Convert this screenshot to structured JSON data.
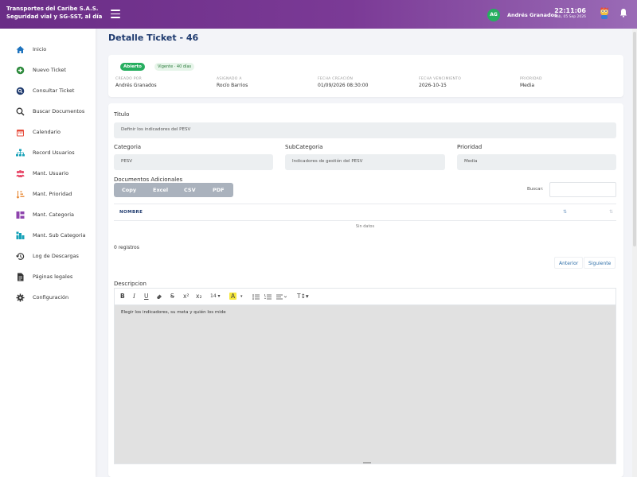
{
  "brand": {
    "line1": "Transportes del Caribe S.A.S.",
    "line2": "Seguridad vial y SG-SST, al día"
  },
  "header": {
    "user_initials": "AG",
    "user_name": "Andrés Granados",
    "time": "22:11:06",
    "date": "Sáb, 05 Sep 2026",
    "icons": [
      "menu-icon",
      "mascot-icon",
      "bell-icon"
    ]
  },
  "sidebar": {
    "items": [
      {
        "label": "Inicio",
        "icon": "home-icon",
        "color": "#1e73be"
      },
      {
        "label": "Nuevo Ticket",
        "icon": "plus-circle-icon",
        "color": "#2e8b3d"
      },
      {
        "label": "Consultar Ticket",
        "icon": "search-ticket-icon",
        "color": "#1e3a6e"
      },
      {
        "label": "Buscar Documentos",
        "icon": "search-icon",
        "color": "#333333"
      },
      {
        "label": "Calendario",
        "icon": "calendar-icon",
        "color": "#e74c3c"
      },
      {
        "label": "Record Usuarios",
        "icon": "sitemap-icon",
        "color": "#17a2b8"
      },
      {
        "label": "Mant. Usuario",
        "icon": "users-icon",
        "color": "#e84a6a"
      },
      {
        "label": "Mant. Prioridad",
        "icon": "sort-priority-icon",
        "color": "#e67e22"
      },
      {
        "label": "Mant. Categoria",
        "icon": "category-icon",
        "color": "#8e44ad"
      },
      {
        "label": "Mant. Sub Categoria",
        "icon": "subcategory-icon",
        "color": "#17a2b8"
      },
      {
        "label": "Log de Descargas",
        "icon": "history-icon",
        "color": "#333333"
      },
      {
        "label": "Páginas legales",
        "icon": "document-icon",
        "color": "#333333"
      },
      {
        "label": "Configuración",
        "icon": "gear-icon",
        "color": "#333333"
      }
    ]
  },
  "page_title": "Detalle Ticket - 46",
  "ticket": {
    "status": "Abierto",
    "vigencia": "Vigente · 40 días",
    "meta": [
      {
        "key": "CREADO POR",
        "value": "Andrés Granados"
      },
      {
        "key": "ASIGNADO A",
        "value": "Rocío Barrios"
      },
      {
        "key": "FECHA CREACIÓN",
        "value": "01/09/2026 08:30:00"
      },
      {
        "key": "FECHA VENCIMIENTO",
        "value": "2026-10-15"
      },
      {
        "key": "PRIORIDAD",
        "value": "Media"
      }
    ]
  },
  "form": {
    "titulo_label": "Titulo",
    "titulo_value": "Definir los indicadores del PESV",
    "categoria_label": "Categoria",
    "categoria_value": "PESV",
    "subcategoria_label": "SubCategoria",
    "subcategoria_value": "Indicadores de gestión del PESV",
    "prioridad_label": "Prioridad",
    "prioridad_value": "Media"
  },
  "documents": {
    "section_label": "Documentos Adicionales",
    "buttons": [
      "Copy",
      "Excel",
      "CSV",
      "PDF"
    ],
    "search_label": "Buscar:",
    "column_header": "NOMBRE",
    "empty_text": "Sin datos",
    "records_text": "0 registros",
    "prev_label": "Anterior",
    "next_label": "Siguiente"
  },
  "editor": {
    "label": "Descripcion",
    "toolbar": [
      "B",
      "I",
      "U",
      "eraser",
      "S",
      "x²",
      "x₂",
      "14",
      "A",
      "ul",
      "ol",
      "align",
      "T"
    ],
    "font_size": "14",
    "content": "Elegir los indicadores, su meta y quién los mide"
  },
  "colors": {
    "topbar_start": "#6a2d86",
    "topbar_end": "#9a6bb6",
    "title": "#1e3a6e",
    "open_badge": "#27ae60"
  }
}
